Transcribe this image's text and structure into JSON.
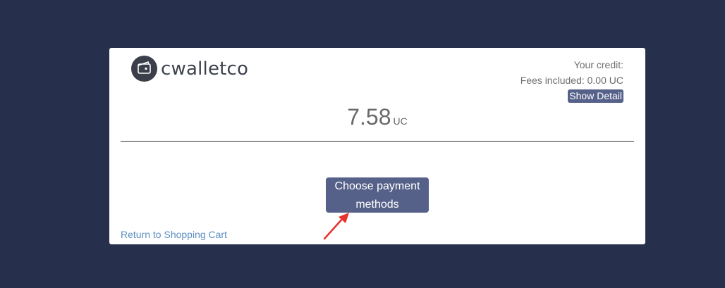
{
  "brand": {
    "name": "cwalletco",
    "logo_icon": "wallet-icon"
  },
  "credit": {
    "label": "Your credit:",
    "fees_label": "Fees included: 0.00 UC",
    "show_detail_label": "Show Detail"
  },
  "amount": {
    "value": "7.58",
    "unit": "UC"
  },
  "actions": {
    "choose_payment_label": "Choose payment methods",
    "return_label": "Return to Shopping Cart"
  },
  "annotation": {
    "icon": "red-arrow-icon"
  },
  "colors": {
    "background": "#26304d",
    "card": "#ffffff",
    "button": "#56618a",
    "link": "#5d8fc1",
    "arrow": "#e8322c"
  }
}
